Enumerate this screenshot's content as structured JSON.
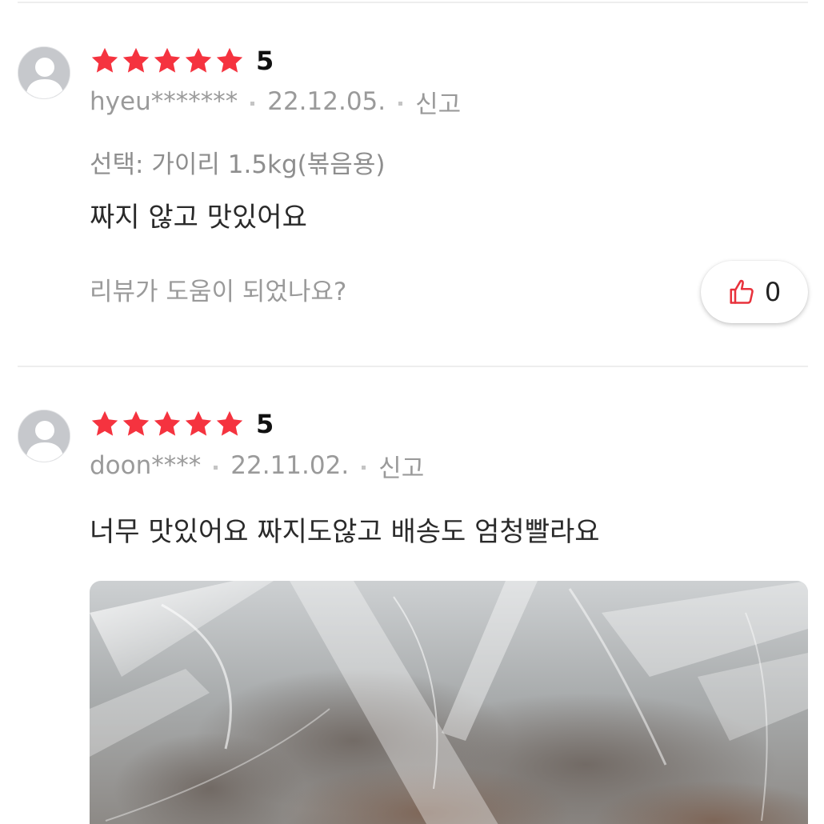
{
  "reviews": [
    {
      "avatar_icon": "default-user-avatar-icon",
      "star_icon": "star-filled-icon",
      "stars_filled": 5,
      "rating": "5",
      "user": "hyeu*******",
      "date": "22.12.05.",
      "report_label": "신고",
      "option": "선택: 가이리 1.5kg(볶음용)",
      "content": "짜지 않고 맛있어요",
      "helpful_question": "리뷰가 도움이 되었나요?",
      "like_icon": "thumbs-up-icon",
      "like_count": "0"
    },
    {
      "avatar_icon": "default-user-avatar-icon",
      "star_icon": "star-filled-icon",
      "stars_filled": 5,
      "rating": "5",
      "user": "doon****",
      "date": "22.11.02.",
      "report_label": "신고",
      "content": "너무 맛있어요 짜지도않고 배송도 엄청빨라요",
      "has_photo": true
    }
  ],
  "colors": {
    "star": "#f5333f",
    "thumb": "#e8323c",
    "muted_text": "#9a9a9a",
    "divider": "#eeeeee"
  }
}
